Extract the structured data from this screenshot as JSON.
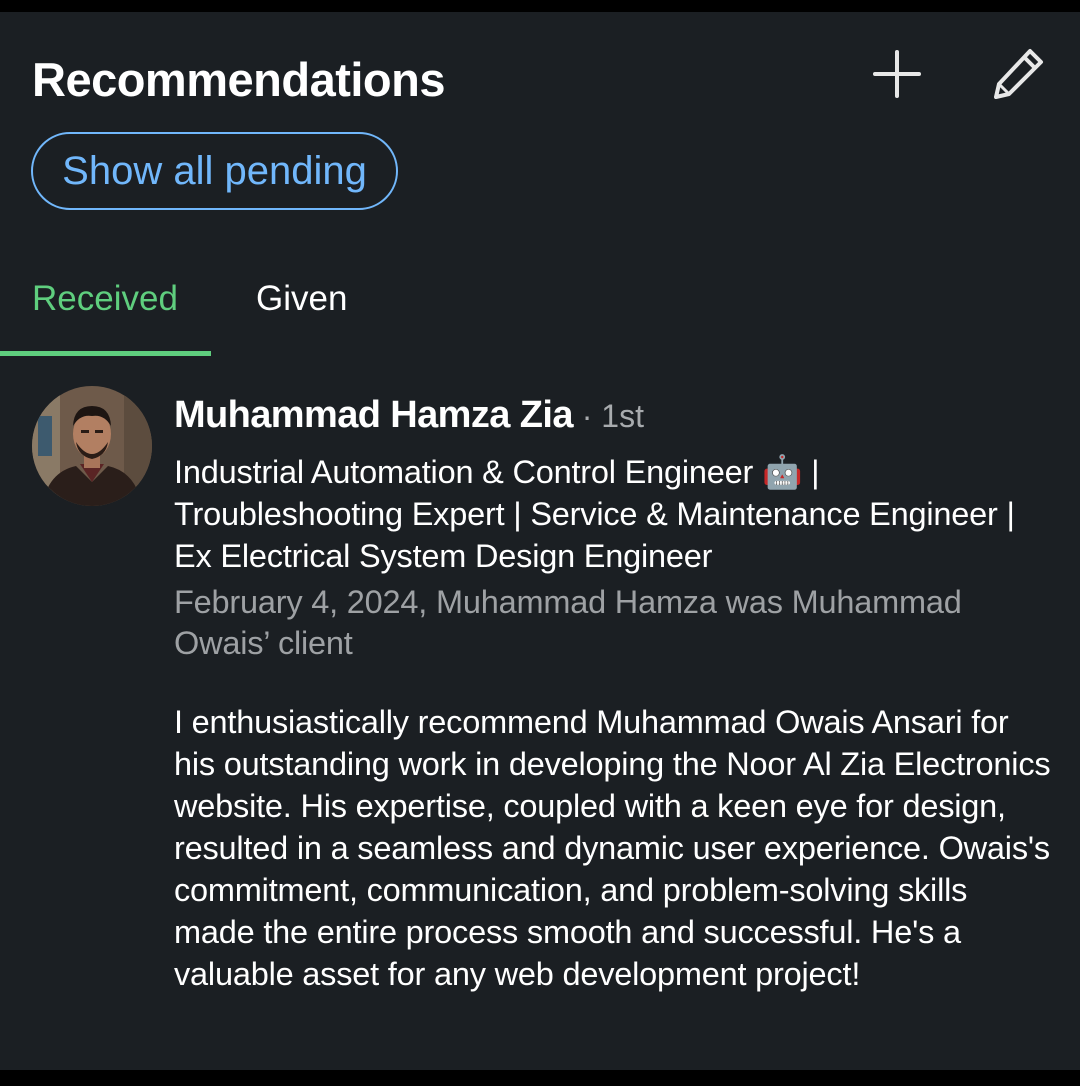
{
  "header": {
    "title": "Recommendations",
    "add_icon": "plus-icon",
    "edit_icon": "pencil-icon"
  },
  "show_all_pending": "Show all pending",
  "tabs": [
    {
      "label": "Received",
      "active": true
    },
    {
      "label": "Given",
      "active": false
    }
  ],
  "recommendation": {
    "name": "Muhammad Hamza Zia",
    "separator": " · ",
    "degree": "1st",
    "headline": "Industrial Automation & Control Engineer 🤖 | Troubleshooting Expert | Service & Maintenance Engineer | Ex Electrical System Design Engineer",
    "meta": "February 4, 2024, Muhammad Hamza was Muhammad Owais’ client",
    "text": "I enthusiastically recommend Muhammad Owais Ansari for his outstanding work in developing the Noor Al Zia Electronics website. His expertise, coupled with a keen eye for design, resulted in a seamless and dynamic user experience. Owais's commitment, communication, and problem-solving skills made the entire process smooth and successful. He's a valuable asset for any web development project!"
  },
  "colors": {
    "background": "#1b1f23",
    "accent_blue": "#71b7fb",
    "accent_green": "#5fce7e",
    "muted_text": "#9ea1a4"
  }
}
